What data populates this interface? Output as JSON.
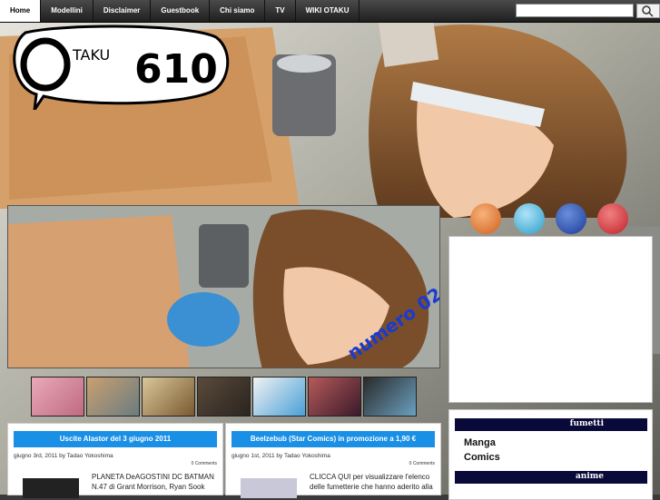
{
  "nav": {
    "items": [
      "Home",
      "Modellini",
      "Disclaimer",
      "Guestbook",
      "Chi siamo",
      "TV",
      "WIKI OTAKU"
    ],
    "active": 0,
    "search_placeholder": ""
  },
  "logo": {
    "text": "OTAKU610"
  },
  "slider": {
    "caption": "numero 02"
  },
  "posts": [
    {
      "title": "Uscite Alastor del 3 giugno 2011",
      "meta": "giugno 3rd, 2011 by Tadao Yokoshima",
      "comments": "0 Comments",
      "body": "PLANETA DeAGOSTINI DC BATMAN N.47 di Grant Morrison, Ryan Sook"
    },
    {
      "title": "Beelzebub (Star Comics) in promozione a 1,90 €",
      "meta": "giugno 1st, 2011 by Tadao Yokoshima",
      "comments": "0 Comments",
      "body": "CLICCA QUI per visualizzare l'elenco delle fumetterie che hanno aderito alla"
    }
  ],
  "sidebar": {
    "fumetti_label": "fumetti",
    "categories": [
      "Manga",
      "Comics"
    ],
    "anime_label": "anime"
  },
  "colors": {
    "accent": "#1a8fe6",
    "nav_bg": "#2a2a2a"
  }
}
